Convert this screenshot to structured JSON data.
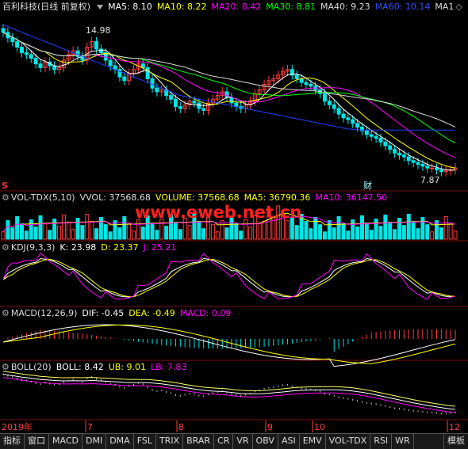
{
  "colors": {
    "up": "#ff3c3c",
    "down": "#00e5e5",
    "ma5": "#ffffff",
    "ma10": "#ffff00",
    "ma20": "#ff00ff",
    "ma30": "#00ff00",
    "ma40": "#d8d8d8",
    "ma60": "#2040ff",
    "dif": "#ffffff",
    "dea": "#ffff00",
    "ub": "#ffff66",
    "lb": "#ff00ff",
    "k": "#ffffff",
    "d": "#ffff00",
    "j": "#ff00ff"
  },
  "main": {
    "title": "百利科技(日线 前复权)",
    "ma5": "MA5: 8.10",
    "ma10": "MA10: 8.22",
    "ma20": "MA20: 8.42",
    "ma30": "MA30: 8.81",
    "ma40": "MA40: 9.23",
    "ma60": "MA60: 10.14",
    "ma_more": "MA1",
    "high_label": "14.98",
    "low_label": "7.87",
    "s_marker": "S",
    "cai_marker": "财"
  },
  "vol": {
    "name": "VOL-TDX(5,10)",
    "vvol": "VVOL: 37568.68",
    "volume": "VOLUME: 37568.68",
    "ma5": "MA5: 36790.36",
    "ma10": "MA10: 36147.50"
  },
  "kdj": {
    "name": "KDJ(9,3,3)",
    "k": "K: 23.98",
    "d": "D: 23.37",
    "j": "J: 25.21"
  },
  "macd": {
    "name": "MACD(12,26,9)",
    "dif": "DIF: -0.45",
    "dea": "DEA: -0.49",
    "macd": "MACD: 0.09"
  },
  "boll": {
    "name": "BOLL(20)",
    "boll": "BOLL: 8.42",
    "ub": "UB: 9.01",
    "lb": "LB: 7.83"
  },
  "x_axis": {
    "year": "2019年",
    "m7": "7",
    "m8": "8",
    "m9": "9",
    "m10": "10",
    "m12": "12"
  },
  "watermark": "www.eweb.net.cn",
  "tabs": [
    "指标",
    "窗口",
    "MACD",
    "DMI",
    "DMA",
    "FSL",
    "TRIX",
    "BRAR",
    "CR",
    "VR",
    "OBV",
    "ASI",
    "EMV",
    "VOL-TDX",
    "RSI",
    "WR"
  ],
  "tab_right": "模板",
  "chart_data": {
    "type": "candlestick",
    "main_ylim": [
      7.0,
      16.2
    ],
    "close": [
      15.4,
      15.1,
      14.9,
      14.6,
      14.3,
      14.2,
      14.0,
      13.7,
      13.5,
      13.8,
      13.6,
      13.4,
      13.5,
      13.9,
      14.2,
      14.4,
      14.1,
      13.9,
      14.6,
      14.9,
      14.5,
      14.3,
      13.9,
      13.6,
      13.4,
      13.0,
      12.8,
      13.2,
      13.4,
      13.7,
      13.5,
      12.9,
      12.4,
      12.2,
      12.3,
      12.0,
      11.8,
      11.4,
      11.3,
      11.5,
      11.7,
      11.6,
      11.3,
      11.2,
      11.6,
      11.8,
      12.0,
      12.2,
      11.9,
      11.6,
      11.4,
      11.3,
      11.5,
      11.7,
      12.1,
      12.3,
      12.6,
      12.8,
      12.9,
      13.1,
      13.3,
      13.4,
      13.1,
      12.9,
      12.7,
      12.6,
      12.5,
      12.3,
      12.1,
      11.7,
      11.5,
      11.3,
      11.0,
      10.8,
      10.7,
      10.5,
      10.3,
      10.1,
      9.9,
      9.8,
      9.7,
      9.5,
      9.3,
      9.1,
      8.9,
      8.8,
      8.7,
      8.5,
      8.4,
      8.3,
      8.2,
      8.1,
      8.1,
      8.0,
      7.9,
      7.95,
      8.0,
      8.1
    ],
    "ma60": [
      15.8,
      15.7,
      15.6,
      15.5,
      15.4,
      15.3,
      15.2,
      15.1,
      15.0,
      14.9,
      14.8,
      14.7,
      14.6,
      14.5,
      14.4,
      14.3,
      14.2,
      14.1,
      14.0,
      13.9,
      13.8,
      13.7,
      13.6,
      13.5,
      13.4,
      13.3,
      13.2,
      13.1,
      13.0,
      12.9,
      12.8,
      12.7,
      12.6,
      12.5,
      12.4,
      12.3,
      12.2,
      12.1,
      12.0,
      11.95,
      11.9,
      11.85,
      11.8,
      11.75,
      11.7,
      11.65,
      11.6,
      11.55,
      11.5,
      11.45,
      11.4,
      11.35,
      11.3,
      11.25,
      11.2,
      11.15,
      11.1,
      11.05,
      11.0,
      10.95,
      10.9,
      10.85,
      10.8,
      10.75,
      10.7,
      10.65,
      10.6,
      10.55,
      10.5,
      10.45,
      10.4,
      10.35,
      10.3,
      10.25,
      10.2,
      10.18,
      10.16,
      10.14,
      10.14,
      10.14,
      10.14,
      10.14,
      10.14,
      10.14,
      10.14,
      10.14,
      10.14,
      10.14,
      10.14,
      10.14,
      10.14,
      10.14,
      10.14,
      10.14,
      10.14,
      10.14,
      10.14,
      10.14
    ],
    "last": {
      "ma5": 8.1,
      "ma10": 8.22,
      "ma20": 8.42,
      "ma30": 8.81,
      "ma40": 9.23,
      "ma60": 10.14
    },
    "volume_last": 37568.68,
    "macd_last": {
      "dif": -0.45,
      "dea": -0.49,
      "macd": 0.09
    },
    "kdj_last": {
      "k": 23.98,
      "d": 23.37,
      "j": 25.21
    },
    "boll_last": {
      "mid": 8.42,
      "ub": 9.01,
      "lb": 7.83
    }
  }
}
